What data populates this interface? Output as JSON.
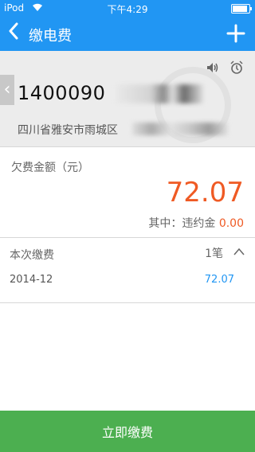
{
  "status_bar": {
    "carrier": "iPod",
    "time": "下午4:29"
  },
  "nav": {
    "title": "缴电费"
  },
  "account": {
    "number": "1400090",
    "address": "四川省雅安市雨城区"
  },
  "arrears": {
    "label": "欠费金额（元）",
    "amount": "72.07",
    "penalty_label": "其中：违约金",
    "penalty_value": "0.00"
  },
  "this_payment": {
    "label": "本次缴费",
    "count": "1笔",
    "items": [
      {
        "period": "2014-12",
        "amount": "72.07"
      }
    ]
  },
  "pay_button": {
    "label": "立即缴费"
  },
  "colors": {
    "primary": "#2196f3",
    "accent": "#ef5a24",
    "button": "#4caf50"
  }
}
